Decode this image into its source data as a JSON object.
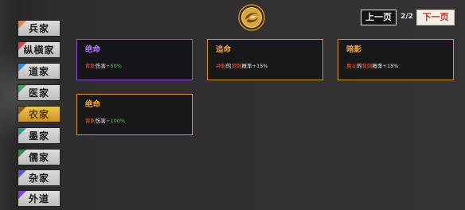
{
  "sidebar": {
    "items": [
      {
        "label": "兵家",
        "color": "#f07a3a"
      },
      {
        "label": "纵横家",
        "color": "#e0404a"
      },
      {
        "label": "道家",
        "color": "#2f8be0"
      },
      {
        "label": "医家",
        "color": "#3aa862"
      },
      {
        "label": "农家",
        "color": "#d8a030",
        "active": true
      },
      {
        "label": "墨家",
        "color": "#2f9d8a"
      },
      {
        "label": "儒家",
        "color": "#2b8f4a"
      },
      {
        "label": "杂家",
        "color": "#5a5ad8"
      },
      {
        "label": "外道",
        "color": "#8b3fd0"
      }
    ]
  },
  "header": {
    "prev_label": "上一页",
    "next_label": "下一页",
    "page_indicator": "2/2",
    "logo_icon": "gold-coin-swirl-icon"
  },
  "cards": [
    {
      "title": "绝命",
      "rarity_color": "#8c4fd7",
      "desc_parts": [
        {
          "text": "背刺",
          "tone": "red"
        },
        {
          "text": "伤害",
          "tone": "white"
        },
        {
          "text": "+50%",
          "tone": "green"
        }
      ]
    },
    {
      "title": "追命",
      "rarity_color": "#d8953a",
      "desc_parts": [
        {
          "text": "冲刺",
          "tone": "red"
        },
        {
          "text": "的",
          "tone": "white"
        },
        {
          "text": "背刺",
          "tone": "red"
        },
        {
          "text": "概率+15%",
          "tone": "white"
        }
      ]
    },
    {
      "title": "暗影",
      "rarity_color": "#d8953a",
      "desc_parts": [
        {
          "text": "奥义",
          "tone": "red"
        },
        {
          "text": "的",
          "tone": "white"
        },
        {
          "text": "背刺",
          "tone": "red"
        },
        {
          "text": "概率+15%",
          "tone": "white"
        }
      ]
    },
    {
      "title": "绝命",
      "rarity_color": "#d8953a",
      "desc_parts": [
        {
          "text": "背刺",
          "tone": "red"
        },
        {
          "text": "伤害",
          "tone": "white"
        },
        {
          "text": "+100%",
          "tone": "green"
        }
      ]
    }
  ]
}
